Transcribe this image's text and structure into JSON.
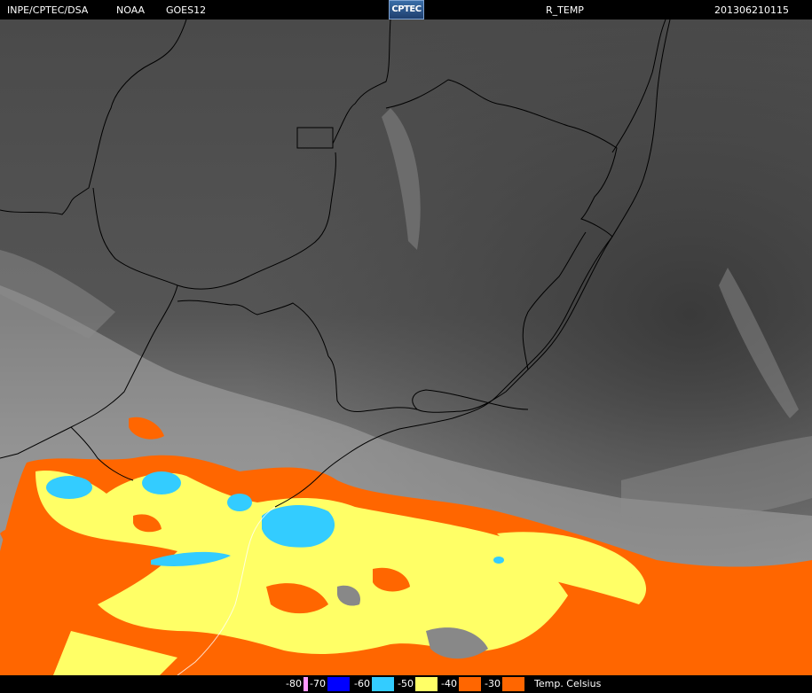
{
  "header": {
    "org": "INPE/CPTEC/DSA",
    "agency": "NOAA",
    "satellite": "GOES12",
    "logo_text": "CPTEC",
    "product": "R_TEMP",
    "datetime": "201306210115"
  },
  "legend": {
    "unit_label": "Temp. Celsius",
    "entries": [
      {
        "label": "-80",
        "color": "#ff99ff"
      },
      {
        "label": "-70",
        "color": "#0000ff"
      },
      {
        "label": "-60",
        "color": "#33ccff"
      },
      {
        "label": "-50",
        "color": "#ffff66"
      },
      {
        "label": "-40",
        "color": "#ff6600"
      },
      {
        "label": "-30",
        "color": "#ff6600"
      }
    ]
  },
  "colors": {
    "ocean_dark": "#414141",
    "land_gray": "#555555",
    "cloud_light": "#a5a5a5",
    "orange": "#ff6600",
    "yellow": "#ffff66",
    "cyan": "#33ccff",
    "border_line": "#000000"
  }
}
